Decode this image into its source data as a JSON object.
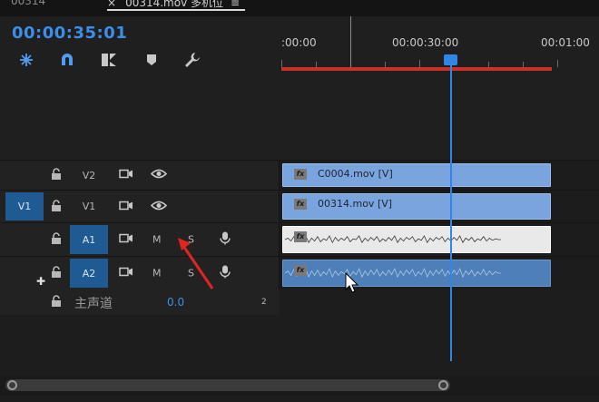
{
  "tabs": {
    "previous_label": "00314",
    "active_label": "00314.mov 多机位",
    "close_glyph": "×",
    "menu_glyph": "≡"
  },
  "timecode": "00:00:35:01",
  "toolbar": {
    "icons": [
      "snap-nest-icon",
      "magnet-icon",
      "linked-selection-icon",
      "marker-icon",
      "wrench-icon"
    ]
  },
  "ruler": {
    "labels": [
      ":00:00",
      "00:00:30:00",
      "00:01:00"
    ]
  },
  "tracks": {
    "video": [
      {
        "name": "V2",
        "source_patch": "",
        "clip": "C0004.mov [V]"
      },
      {
        "name": "V1",
        "source_patch": "V1",
        "clip": "00314.mov [V]"
      }
    ],
    "audio": [
      {
        "name": "A1",
        "mute": "M",
        "solo": "S"
      },
      {
        "name": "A2",
        "mute": "M",
        "solo": "S"
      }
    ],
    "fx_label": "fx",
    "master": {
      "label": "主声道",
      "value": "0.0",
      "channel_badge": "2"
    }
  },
  "colors": {
    "accent": "#2f86e6",
    "timecode": "#3d8ee8",
    "workarea": "#c8322a",
    "video_clip": "#7aa4de",
    "audio_clip": "#4f7fb8",
    "source_patch": "#1f5a93"
  }
}
